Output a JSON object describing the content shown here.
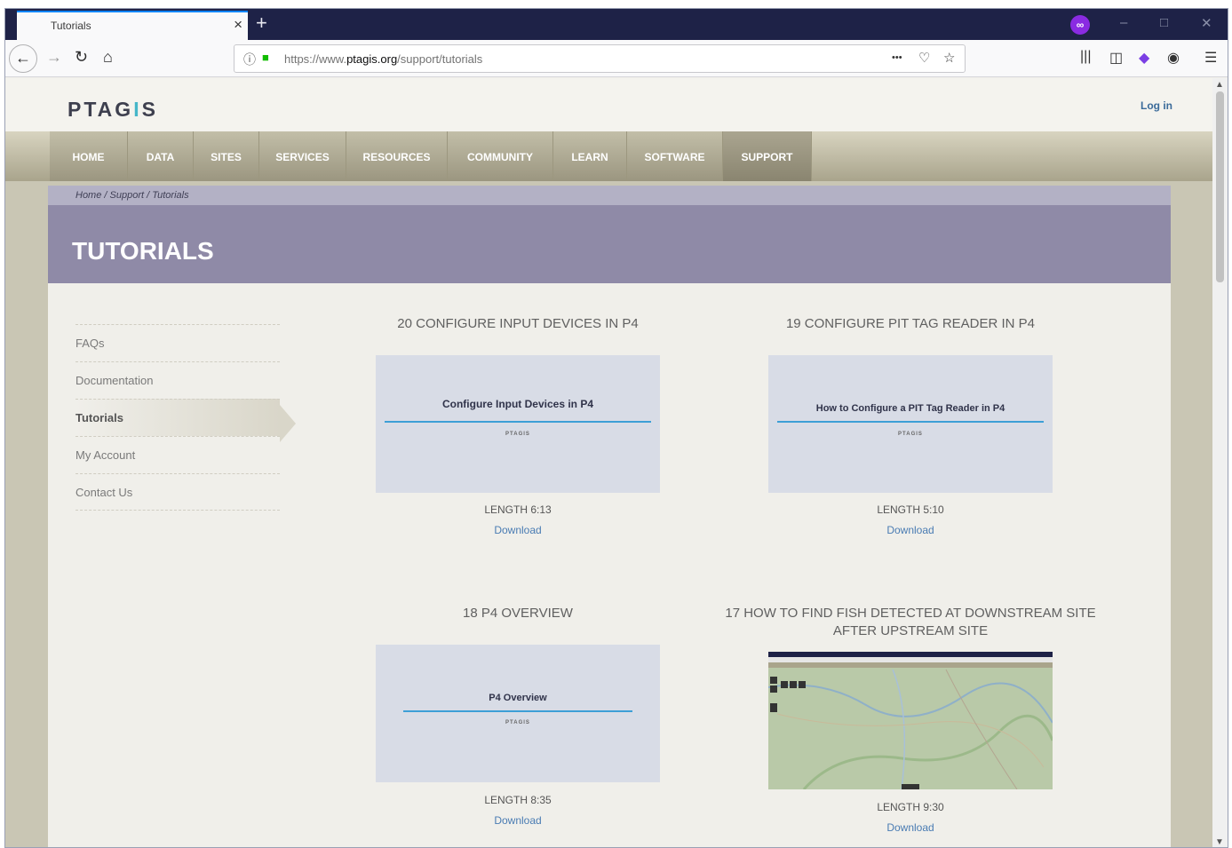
{
  "browser": {
    "tab_title": "Tutorials",
    "tab_close": "×",
    "new_tab": "+",
    "ext_tab_icon": "∞",
    "url_prefix": "https://www.",
    "url_domain": "ptagis.org",
    "url_path": "/support/tutorials",
    "page_actions": "•••",
    "win_min": "–",
    "win_max": "□",
    "win_close": "✕"
  },
  "site": {
    "logo_pre": "PTAG",
    "logo_i": "I",
    "logo_post": "S",
    "login": "Log in",
    "nav": [
      "HOME",
      "DATA",
      "SITES",
      "SERVICES",
      "RESOURCES",
      "COMMUNITY",
      "LEARN",
      "SOFTWARE",
      "SUPPORT"
    ],
    "breadcrumb": "Home /  Support /  Tutorials",
    "page_title": "TUTORIALS",
    "sidebar": [
      "FAQs",
      "Documentation",
      "Tutorials",
      "My Account",
      "Contact Us"
    ]
  },
  "videos": [
    {
      "title": "20 CONFIGURE INPUT DEVICES IN P4",
      "thumb_title": "Configure Input Devices in P4",
      "brand": "PTAGIS",
      "length": "LENGTH 6:13",
      "download": "Download"
    },
    {
      "title": "19 CONFIGURE PIT TAG READER IN P4",
      "thumb_title": "How to Configure a PIT Tag Reader in P4",
      "brand": "PTAGIS",
      "length": "LENGTH 5:10",
      "download": "Download"
    },
    {
      "title": "18 P4 OVERVIEW",
      "thumb_title": "P4 Overview",
      "brand": "PTAGIS",
      "length": "LENGTH 8:35",
      "download": "Download"
    },
    {
      "title": "17 HOW TO FIND FISH DETECTED AT DOWNSTREAM SITE AFTER UPSTREAM SITE",
      "thumb_title": "",
      "brand": "",
      "length": "LENGTH 9:30",
      "download": "Download"
    }
  ],
  "colors": {
    "accent": "#3d9fd6",
    "hero": "#8f8aa7",
    "link": "#4a7cb3"
  }
}
